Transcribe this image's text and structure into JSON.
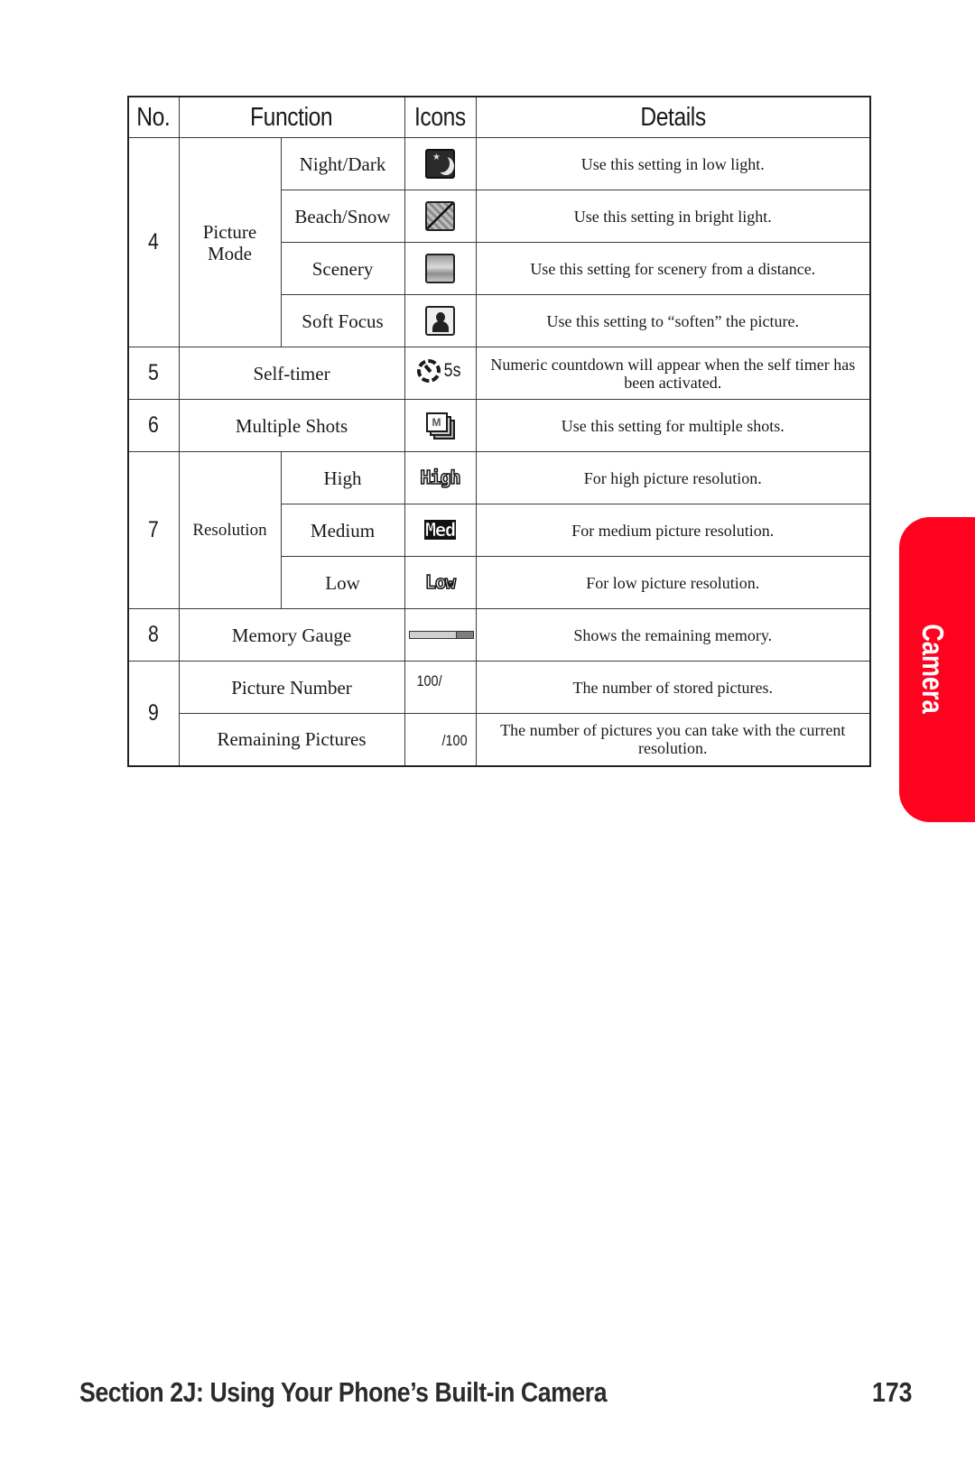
{
  "table": {
    "headers": {
      "no": "No.",
      "function": "Function",
      "icons": "Icons",
      "details": "Details"
    },
    "rows": {
      "r4": {
        "no": "4",
        "group": "Picture Mode",
        "items": [
          {
            "label": "Night/Dark",
            "icon": "night-dark-icon",
            "details": "Use this setting in low light."
          },
          {
            "label": "Beach/Snow",
            "icon": "beach-snow-icon",
            "details": "Use this setting in bright light."
          },
          {
            "label": "Scenery",
            "icon": "scenery-icon",
            "details": "Use this setting for scenery from a distance."
          },
          {
            "label": "Soft Focus",
            "icon": "soft-focus-icon",
            "details": "Use this setting to “soften” the picture."
          }
        ]
      },
      "r5": {
        "no": "5",
        "label": "Self-timer",
        "icon": "self-timer-icon",
        "icon_text": "5s",
        "details": "Numeric countdown will appear when the self timer has been activated."
      },
      "r6": {
        "no": "6",
        "label": "Multiple Shots",
        "icon": "multiple-shots-icon",
        "icon_text": "M",
        "details": "Use this setting for multiple shots."
      },
      "r7": {
        "no": "7",
        "group": "Resolution",
        "items": [
          {
            "label": "High",
            "icon_text": "High",
            "details": "For high picture resolution."
          },
          {
            "label": "Medium",
            "icon_text": "Med",
            "details": "For medium picture resolution."
          },
          {
            "label": "Low",
            "icon_text": "Low",
            "details": "For low picture resolution."
          }
        ]
      },
      "r8": {
        "no": "8",
        "label": "Memory Gauge",
        "icon": "memory-gauge-icon",
        "gauge_used_fraction": 0.27,
        "details": "Shows the remaining memory."
      },
      "r9": {
        "no": "9",
        "items": [
          {
            "label": "Picture Number",
            "icon_text": "100/",
            "details": "The number of stored pictures."
          },
          {
            "label": "Remaining Pictures",
            "icon_text": "/100",
            "details": "The number of pictures you can take with the current resolution."
          }
        ]
      }
    }
  },
  "side_tab": {
    "label": "Camera",
    "color": "#ff0220"
  },
  "footer": {
    "title": "Section 2J: Using Your Phone’s Built-in Camera",
    "page": "173"
  }
}
